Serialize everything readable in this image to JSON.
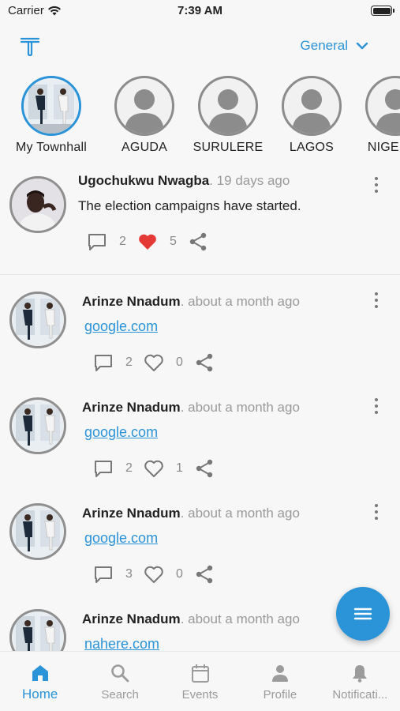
{
  "status_bar": {
    "carrier": "Carrier",
    "time": "7:39 AM"
  },
  "header": {
    "category": "General"
  },
  "stories": [
    {
      "label": "My Townhall",
      "type": "photo",
      "active": true
    },
    {
      "label": "AGUDA",
      "type": "placeholder"
    },
    {
      "label": "SURULERE",
      "type": "placeholder"
    },
    {
      "label": "LAGOS",
      "type": "placeholder"
    },
    {
      "label": "NIGERI...",
      "type": "placeholder"
    }
  ],
  "posts": [
    {
      "author": "Ugochukwu Nwagba",
      "time": ". 19 days ago",
      "text": "The election campaigns have started.",
      "comments": "2",
      "likes": "5",
      "liked": true
    },
    {
      "author": "Arinze Nnadum",
      "time": ". about a month ago",
      "link": "google.com",
      "comments": "2",
      "likes": "0",
      "liked": false
    },
    {
      "author": "Arinze Nnadum",
      "time": ". about a month ago",
      "link": "google.com",
      "comments": "2",
      "likes": "1",
      "liked": false
    },
    {
      "author": "Arinze Nnadum",
      "time": ". about a month ago",
      "link": "google.com",
      "comments": "3",
      "likes": "0",
      "liked": false
    },
    {
      "author": "Arinze Nnadum",
      "time": ". about a month ago",
      "link": "nahere.com"
    }
  ],
  "nav": [
    {
      "label": "Home",
      "icon": "home-icon",
      "active": true
    },
    {
      "label": "Search",
      "icon": "search-icon"
    },
    {
      "label": "Events",
      "icon": "calendar-icon"
    },
    {
      "label": "Profile",
      "icon": "person-icon"
    },
    {
      "label": "Notificati...",
      "icon": "bell-icon"
    }
  ],
  "colors": {
    "accent": "#2b93d8",
    "like": "#e53935",
    "muted": "#9a9a9a"
  }
}
